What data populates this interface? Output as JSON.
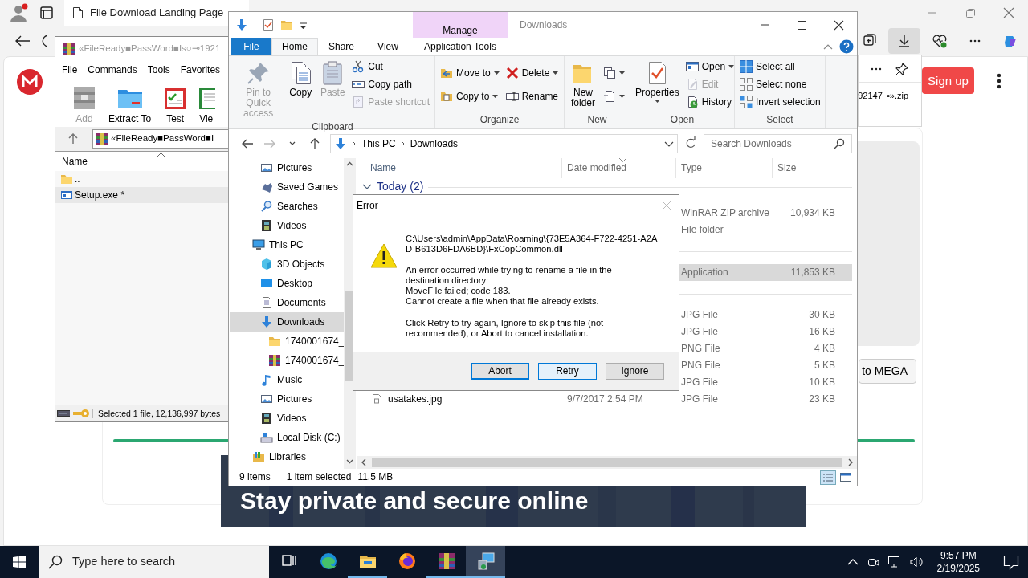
{
  "browser": {
    "tabs": [
      {
        "label": "File Download Landing Page",
        "selected": true
      }
    ],
    "download_panel": {
      "filename": "92147⊸».zip"
    },
    "signup": "Sign up",
    "cta": "to MEGA",
    "banner": "Stay private and secure online"
  },
  "winrar": {
    "title": "«FileReady■PassWord■Is○⊸1921",
    "menu": [
      "File",
      "Commands",
      "Tools",
      "Favorites"
    ],
    "tools": [
      {
        "label": "Add",
        "disabled": true
      },
      {
        "label": "Extract To",
        "disabled": false
      },
      {
        "label": "Test",
        "disabled": false
      },
      {
        "label": "Vie",
        "disabled": false
      }
    ],
    "path": "«FileReady■PassWord■I",
    "columns": [
      "Name"
    ],
    "files": [
      {
        "name": "..",
        "kind": "folder",
        "selected": false
      },
      {
        "name": "Setup.exe *",
        "kind": "exe",
        "selected": true
      }
    ],
    "status": "Selected 1 file, 12,136,997 bytes"
  },
  "explorer": {
    "title": "Downloads",
    "context_tab": "Manage",
    "ribbon_tabs": [
      {
        "label": "File",
        "kind": "file",
        "selected": false
      },
      {
        "label": "Home",
        "kind": "tab",
        "selected": true
      },
      {
        "label": "Share",
        "kind": "tab",
        "selected": false
      },
      {
        "label": "View",
        "kind": "tab",
        "selected": false
      },
      {
        "label": "Application Tools",
        "kind": "context",
        "selected": false
      }
    ],
    "ribbon_groups": [
      {
        "label": "Clipboard",
        "columns": [
          [
            {
              "kind": "large",
              "label": "Pin to Quick access",
              "disabled": true
            }
          ],
          [
            {
              "kind": "large",
              "label": "Copy",
              "disabled": false
            }
          ],
          [
            {
              "kind": "large",
              "label": "Paste",
              "disabled": true
            }
          ],
          [
            {
              "kind": "small",
              "label": "Cut",
              "disabled": false
            },
            {
              "kind": "small",
              "label": "Copy path",
              "disabled": false
            },
            {
              "kind": "small",
              "label": "Paste shortcut",
              "disabled": true
            }
          ]
        ]
      },
      {
        "label": "Organize",
        "columns": [
          [
            {
              "kind": "small",
              "label": "Move to",
              "disabled": false,
              "dropdown": true
            },
            {
              "kind": "small",
              "label": "Copy to",
              "disabled": false,
              "dropdown": true
            }
          ],
          [
            {
              "kind": "small",
              "label": "Delete",
              "disabled": false,
              "dropdown": true
            },
            {
              "kind": "small",
              "label": "Rename",
              "disabled": false
            }
          ]
        ]
      },
      {
        "label": "New",
        "columns": [
          [
            {
              "kind": "large",
              "label": "New folder",
              "disabled": false
            }
          ],
          [
            {
              "kind": "small",
              "disabled": false,
              "dropdown": true
            },
            {
              "kind": "small",
              "disabled": false,
              "dropdown": true
            }
          ]
        ]
      },
      {
        "label": "Open",
        "columns": [
          [
            {
              "kind": "large",
              "label": "Properties",
              "disabled": false,
              "dropdown": true
            }
          ],
          [
            {
              "kind": "small",
              "label": "Open",
              "disabled": false,
              "dropdown": true
            },
            {
              "kind": "small",
              "label": "Edit",
              "disabled": true
            },
            {
              "kind": "small",
              "label": "History",
              "disabled": false
            }
          ]
        ]
      },
      {
        "label": "Select",
        "columns": [
          [
            {
              "kind": "small",
              "label": "Select all",
              "disabled": false
            },
            {
              "kind": "small",
              "label": "Select none",
              "disabled": false
            },
            {
              "kind": "small",
              "label": "Invert selection",
              "disabled": false
            }
          ]
        ]
      }
    ],
    "address": [
      "This PC",
      "Downloads"
    ],
    "search": {
      "placeholder": "Search Downloads"
    },
    "nav": [
      {
        "children": [
          {
            "label": "Pictures",
            "selected": false
          },
          {
            "label": "Saved Games",
            "selected": false
          },
          {
            "label": "Searches",
            "selected": false
          },
          {
            "label": "Videos",
            "selected": false
          }
        ]
      },
      {
        "label": "This PC",
        "selected": false,
        "children": [
          {
            "label": "3D Objects",
            "selected": false
          },
          {
            "label": "Desktop",
            "selected": false
          },
          {
            "label": "Documents",
            "selected": false
          },
          {
            "label": "Downloads",
            "selected": true,
            "children": [
              {
                "label": "1740001674_",
                "selected": false
              },
              {
                "label": "1740001674_",
                "selected": false
              }
            ]
          },
          {
            "label": "Music",
            "selected": false
          },
          {
            "label": "Pictures",
            "selected": false
          },
          {
            "label": "Videos",
            "selected": false
          },
          {
            "label": "Local Disk (C:)",
            "selected": false
          }
        ]
      },
      {
        "label": "Libraries",
        "selected": false
      }
    ],
    "columns": [
      {
        "label": "Name",
        "sorted": false
      },
      {
        "label": "Date modified",
        "sorted": true
      },
      {
        "label": "Type",
        "sorted": false
      },
      {
        "label": "Size",
        "sorted": false
      }
    ],
    "list": [
      {
        "kind": "group",
        "label": "Today (2)",
        "expanded": true
      },
      {
        "kind": "file",
        "type": "WinRAR ZIP archive",
        "size": "10,934 KB",
        "selected": false
      },
      {
        "kind": "file",
        "type": "File folder",
        "selected": false
      },
      {
        "kind": "group"
      },
      {
        "kind": "file",
        "type": "Application",
        "size": "11,853 KB",
        "selected": true
      },
      {
        "kind": "group"
      },
      {
        "kind": "file",
        "type": "JPG File",
        "size": "30 KB",
        "selected": false
      },
      {
        "kind": "file",
        "type": "JPG File",
        "size": "16 KB",
        "selected": false
      },
      {
        "kind": "file",
        "type": "PNG File",
        "size": "4 KB",
        "selected": false
      },
      {
        "kind": "file",
        "type": "PNG File",
        "size": "5 KB",
        "selected": false
      },
      {
        "kind": "file",
        "type": "JPG File",
        "size": "10 KB",
        "selected": false
      },
      {
        "kind": "file",
        "name": "usatakes.jpg",
        "date": "9/7/2017 2:54 PM",
        "type": "JPG File",
        "size": "23 KB",
        "selected": false
      }
    ],
    "status": {
      "count": "9 items",
      "selection": "1 item selected",
      "selection_size": "11.5 MB"
    }
  },
  "dialog": {
    "title": "Error",
    "paragraphs": [
      [
        "C:\\Users\\admin\\AppData\\Roaming\\{73E5A364-F722-4251-A2A",
        "D-B613D6FDA6BD}\\FxCopCommon.dll"
      ],
      [
        "An error occurred while trying to rename a file in the",
        "destination directory:",
        "MoveFile failed; code 183.",
        "Cannot create a file when that file already exists."
      ],
      [
        "Click Retry to try again, Ignore to skip this file (not",
        "recommended), or Abort to cancel installation."
      ]
    ],
    "buttons": [
      {
        "label": "Abort",
        "focused": true,
        "hovered": false
      },
      {
        "label": "Retry",
        "focused": false,
        "hovered": true
      },
      {
        "label": "Ignore",
        "focused": false,
        "hovered": false
      }
    ]
  },
  "taskbar": {
    "search_placeholder": "Type here to search",
    "apps": [
      {
        "running": false,
        "selected": false
      },
      {
        "running": false,
        "selected": false
      },
      {
        "running": true,
        "selected": false
      },
      {
        "running": false,
        "selected": false
      },
      {
        "running": true,
        "selected": false
      },
      {
        "running": true,
        "selected": true
      }
    ],
    "time": "9:57 PM",
    "date": "2/19/2025"
  }
}
